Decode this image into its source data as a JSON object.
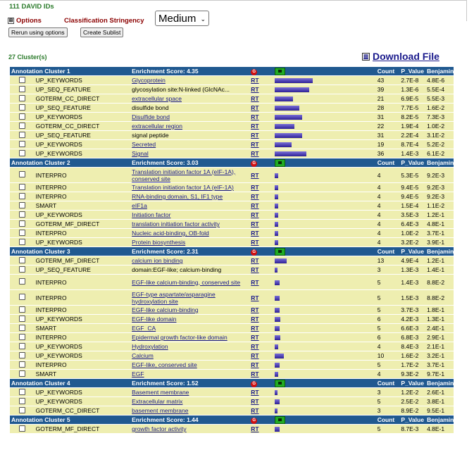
{
  "header": {
    "ids_label": "111 DAVID IDs",
    "options_toggle": "⊞",
    "options_label": "Options",
    "stringency_label": "Classification Stringency",
    "stringency_value": "Medium",
    "rerun_button": "Rerun using options",
    "sublist_button": "Create Sublist",
    "cluster_count": "27 Cluster(s)",
    "download_label": "Download File"
  },
  "table_labels": {
    "count": "Count",
    "pvalue": "P_Value",
    "benjamini": "Benjamini",
    "rt": "RT"
  },
  "clusters": [
    {
      "title": "Annotation Cluster 1",
      "score": "Enrichment Score: 4.35",
      "rows": [
        {
          "category": "UP_KEYWORDS",
          "term": "Glycoprotein",
          "link": true,
          "bar": 0.9,
          "count": "43",
          "p": "2.7E-8",
          "b": "4.8E-6"
        },
        {
          "category": "UP_SEQ_FEATURE",
          "term": "glycosylation site:N-linked (GlcNAc...",
          "link": false,
          "bar": 0.82,
          "count": "39",
          "p": "1.3E-6",
          "b": "5.5E-4"
        },
        {
          "category": "GOTERM_CC_DIRECT",
          "term": "extracellular space",
          "link": true,
          "bar": 0.44,
          "count": "21",
          "p": "6.9E-5",
          "b": "5.5E-3"
        },
        {
          "category": "UP_SEQ_FEATURE",
          "term": "disulfide bond",
          "link": false,
          "bar": 0.59,
          "count": "28",
          "p": "7.7E-5",
          "b": "1.6E-2"
        },
        {
          "category": "UP_KEYWORDS",
          "term": "Disulfide bond",
          "link": true,
          "bar": 0.65,
          "count": "31",
          "p": "8.2E-5",
          "b": "7.3E-3"
        },
        {
          "category": "GOTERM_CC_DIRECT",
          "term": "extracellular region",
          "link": true,
          "bar": 0.46,
          "count": "22",
          "p": "1.9E-4",
          "b": "1.0E-2"
        },
        {
          "category": "UP_SEQ_FEATURE",
          "term": "signal peptide",
          "link": false,
          "bar": 0.65,
          "count": "31",
          "p": "2.2E-4",
          "b": "3.1E-2"
        },
        {
          "category": "UP_KEYWORDS",
          "term": "Secreted",
          "link": true,
          "bar": 0.4,
          "count": "19",
          "p": "8.7E-4",
          "b": "5.2E-2"
        },
        {
          "category": "UP_KEYWORDS",
          "term": "Signal",
          "link": true,
          "bar": 0.75,
          "count": "36",
          "p": "1.4E-3",
          "b": "6.1E-2"
        }
      ]
    },
    {
      "title": "Annotation Cluster 2",
      "score": "Enrichment Score: 3.03",
      "rows": [
        {
          "category": "INTERPRO",
          "term": "Translation initiation factor 1A (eIF-1A), conserved site",
          "link": true,
          "tall": true,
          "bar": 0.09,
          "count": "4",
          "p": "5.3E-5",
          "b": "9.2E-3"
        },
        {
          "category": "INTERPRO",
          "term": "Translation initiation factor 1A (eIF-1A)",
          "link": true,
          "bar": 0.09,
          "count": "4",
          "p": "9.4E-5",
          "b": "9.2E-3"
        },
        {
          "category": "INTERPRO",
          "term": "RNA-binding domain, S1, IF1 type",
          "link": true,
          "bar": 0.09,
          "count": "4",
          "p": "9.4E-5",
          "b": "9.2E-3"
        },
        {
          "category": "SMART",
          "term": "eIF1a",
          "link": true,
          "bar": 0.09,
          "count": "4",
          "p": "1.5E-4",
          "b": "1.1E-2"
        },
        {
          "category": "UP_KEYWORDS",
          "term": "Initiation factor",
          "link": true,
          "bar": 0.09,
          "count": "4",
          "p": "3.5E-3",
          "b": "1.2E-1"
        },
        {
          "category": "GOTERM_MF_DIRECT",
          "term": "translation initiation factor activity",
          "link": true,
          "bar": 0.09,
          "count": "4",
          "p": "6.4E-3",
          "b": "4.8E-1"
        },
        {
          "category": "INTERPRO",
          "term": "Nucleic acid-binding, OB-fold",
          "link": true,
          "bar": 0.09,
          "count": "4",
          "p": "1.0E-2",
          "b": "3.7E-1"
        },
        {
          "category": "UP_KEYWORDS",
          "term": "Protein biosynthesis",
          "link": true,
          "bar": 0.09,
          "count": "4",
          "p": "3.2E-2",
          "b": "3.9E-1"
        }
      ]
    },
    {
      "title": "Annotation Cluster 3",
      "score": "Enrichment Score: 2.31",
      "rows": [
        {
          "category": "GOTERM_MF_DIRECT",
          "term": "calcium ion binding",
          "link": true,
          "bar": 0.28,
          "count": "13",
          "p": "4.9E-4",
          "b": "1.2E-1"
        },
        {
          "category": "UP_SEQ_FEATURE",
          "term": "domain:EGF-like; calcium-binding",
          "link": false,
          "bar": 0.07,
          "count": "3",
          "p": "1.3E-3",
          "b": "1.4E-1"
        },
        {
          "category": "INTERPRO",
          "term": "EGF-like calcium-binding, conserved site",
          "link": true,
          "tall": true,
          "bar": 0.11,
          "count": "5",
          "p": "1.4E-3",
          "b": "8.8E-2"
        },
        {
          "category": "INTERPRO",
          "term": "EGF-type aspartate/asparagine hydroxylation site",
          "link": true,
          "tall": true,
          "bar": 0.11,
          "count": "5",
          "p": "1.5E-3",
          "b": "8.8E-2"
        },
        {
          "category": "INTERPRO",
          "term": "EGF-like calcium-binding",
          "link": true,
          "bar": 0.11,
          "count": "5",
          "p": "3.7E-3",
          "b": "1.8E-1"
        },
        {
          "category": "UP_KEYWORDS",
          "term": "EGF-like domain",
          "link": true,
          "bar": 0.13,
          "count": "6",
          "p": "4.2E-3",
          "b": "1.3E-1"
        },
        {
          "category": "SMART",
          "term": "EGF_CA",
          "link": true,
          "bar": 0.11,
          "count": "5",
          "p": "6.6E-3",
          "b": "2.4E-1"
        },
        {
          "category": "INTERPRO",
          "term": "Epidermal growth factor-like domain",
          "link": true,
          "bar": 0.13,
          "count": "6",
          "p": "6.8E-3",
          "b": "2.9E-1"
        },
        {
          "category": "UP_KEYWORDS",
          "term": "Hydroxylation",
          "link": true,
          "bar": 0.09,
          "count": "4",
          "p": "8.4E-3",
          "b": "2.1E-1"
        },
        {
          "category": "UP_KEYWORDS",
          "term": "Calcium",
          "link": true,
          "bar": 0.21,
          "count": "10",
          "p": "1.6E-2",
          "b": "3.2E-1"
        },
        {
          "category": "INTERPRO",
          "term": "EGF-like, conserved site",
          "link": true,
          "bar": 0.11,
          "count": "5",
          "p": "1.7E-2",
          "b": "3.7E-1"
        },
        {
          "category": "SMART",
          "term": "EGF",
          "link": true,
          "bar": 0.09,
          "count": "4",
          "p": "9.3E-2",
          "b": "9.7E-1"
        }
      ]
    },
    {
      "title": "Annotation Cluster 4",
      "score": "Enrichment Score: 1.52",
      "rows": [
        {
          "category": "UP_KEYWORDS",
          "term": "Basement membrane",
          "link": true,
          "bar": 0.07,
          "count": "3",
          "p": "1.2E-2",
          "b": "2.6E-1"
        },
        {
          "category": "UP_KEYWORDS",
          "term": "Extracellular matrix",
          "link": true,
          "bar": 0.11,
          "count": "5",
          "p": "2.5E-2",
          "b": "3.8E-1"
        },
        {
          "category": "GOTERM_CC_DIRECT",
          "term": "basement membrane",
          "link": true,
          "bar": 0.07,
          "count": "3",
          "p": "8.9E-2",
          "b": "9.5E-1"
        }
      ]
    },
    {
      "title": "Annotation Cluster 5",
      "score": "Enrichment Score: 1.44",
      "rows": [
        {
          "category": "GOTERM_MF_DIRECT",
          "term": "growth factor activity",
          "link": true,
          "bar": 0.11,
          "count": "5",
          "p": "8.7E-3",
          "b": "4.8E-1"
        }
      ]
    }
  ]
}
